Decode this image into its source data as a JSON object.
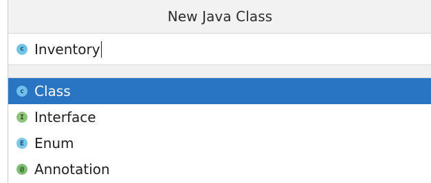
{
  "dialog": {
    "title": "New Java Class"
  },
  "name_field": {
    "value": "Inventory",
    "icon": "class-icon"
  },
  "kinds": [
    {
      "label": "Class",
      "badge": "C",
      "icon": "class-icon",
      "selected": true
    },
    {
      "label": "Interface",
      "badge": "I",
      "icon": "interface-icon",
      "selected": false
    },
    {
      "label": "Enum",
      "badge": "E",
      "icon": "enum-icon",
      "selected": false
    },
    {
      "label": "Annotation",
      "badge": "@",
      "icon": "annotation-icon",
      "selected": false
    }
  ],
  "colors": {
    "selection": "#2a74c4",
    "class_badge": "#72c3e8",
    "interface_badge": "#8fc47c",
    "annotation_badge": "#7fbf73"
  }
}
